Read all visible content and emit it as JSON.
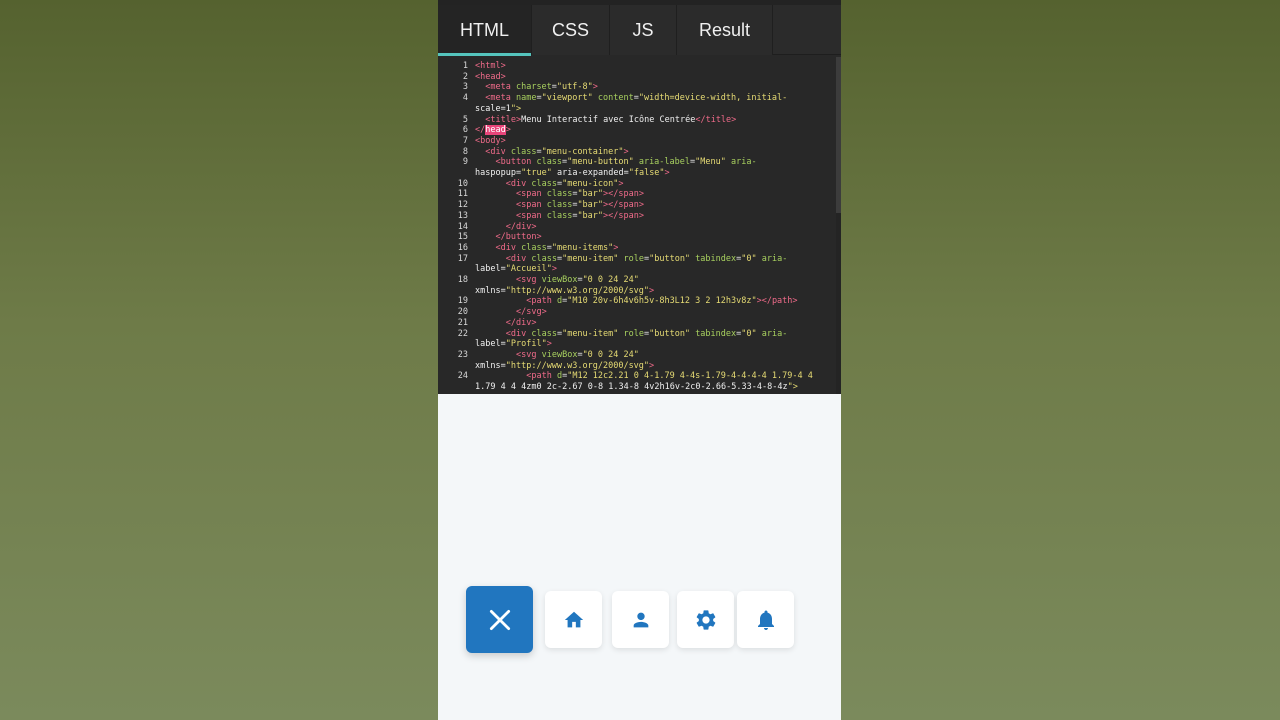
{
  "tabs": [
    {
      "label": "HTML",
      "active": true
    },
    {
      "label": "CSS",
      "active": false
    },
    {
      "label": "JS",
      "active": false
    },
    {
      "label": "Result",
      "active": false
    }
  ],
  "code_lines": [
    {
      "n": "1",
      "t": "<html>"
    },
    {
      "n": "2",
      "t": "<head>"
    },
    {
      "n": "3",
      "t": "  <meta charset=\"utf-8\">"
    },
    {
      "n": "4",
      "t": "  <meta name=\"viewport\" content=\"width=device-width, initial-"
    },
    {
      "n": "",
      "t": "scale=1\">"
    },
    {
      "n": "5",
      "t": "  <title>Menu Interactif avec Icône Centrée</title>"
    },
    {
      "n": "6",
      "t": "</head>"
    },
    {
      "n": "7",
      "t": "<body>"
    },
    {
      "n": "8",
      "t": "  <div class=\"menu-container\">"
    },
    {
      "n": "9",
      "t": "    <button class=\"menu-button\" aria-label=\"Menu\" aria-"
    },
    {
      "n": "",
      "t": "haspopup=\"true\" aria-expanded=\"false\">"
    },
    {
      "n": "10",
      "t": "      <div class=\"menu-icon\">"
    },
    {
      "n": "11",
      "t": "        <span class=\"bar\"></span>"
    },
    {
      "n": "12",
      "t": "        <span class=\"bar\"></span>"
    },
    {
      "n": "13",
      "t": "        <span class=\"bar\"></span>"
    },
    {
      "n": "14",
      "t": "      </div>"
    },
    {
      "n": "15",
      "t": "    </button>"
    },
    {
      "n": "16",
      "t": "    <div class=\"menu-items\">"
    },
    {
      "n": "17",
      "t": "      <div class=\"menu-item\" role=\"button\" tabindex=\"0\" aria-"
    },
    {
      "n": "",
      "t": "label=\"Accueil\">"
    },
    {
      "n": "18",
      "t": "        <svg viewBox=\"0 0 24 24\""
    },
    {
      "n": "",
      "t": "xmlns=\"http://www.w3.org/2000/svg\">"
    },
    {
      "n": "19",
      "t": "          <path d=\"M10 20v-6h4v6h5v-8h3L12 3 2 12h3v8z\"></path>"
    },
    {
      "n": "20",
      "t": "        </svg>"
    },
    {
      "n": "21",
      "t": "      </div>"
    },
    {
      "n": "22",
      "t": "      <div class=\"menu-item\" role=\"button\" tabindex=\"0\" aria-"
    },
    {
      "n": "",
      "t": "label=\"Profil\">"
    },
    {
      "n": "23",
      "t": "        <svg viewBox=\"0 0 24 24\""
    },
    {
      "n": "",
      "t": "xmlns=\"http://www.w3.org/2000/svg\">"
    },
    {
      "n": "24",
      "t": "          <path d=\"M12 12c2.21 0 4-1.79 4-4s-1.79-4-4-4-4 1.79-4 4"
    },
    {
      "n": "",
      "t": "1.79 4 4 4zm0 2c-2.67 0-8 1.34-8 4v2h16v-2c0-2.66-5.33-4-8-4z\">"
    }
  ],
  "menu": {
    "toggle_icon": "close-icon",
    "items": [
      {
        "icon": "home-icon"
      },
      {
        "icon": "user-icon"
      },
      {
        "icon": "gear-icon"
      },
      {
        "icon": "bell-icon"
      }
    ]
  },
  "colors": {
    "accent": "#55c4bd",
    "menu_button": "#2176bf",
    "icon": "#2176bf",
    "tag": "#f06b8a",
    "attr": "#a8d05f",
    "string": "#e6db74"
  }
}
